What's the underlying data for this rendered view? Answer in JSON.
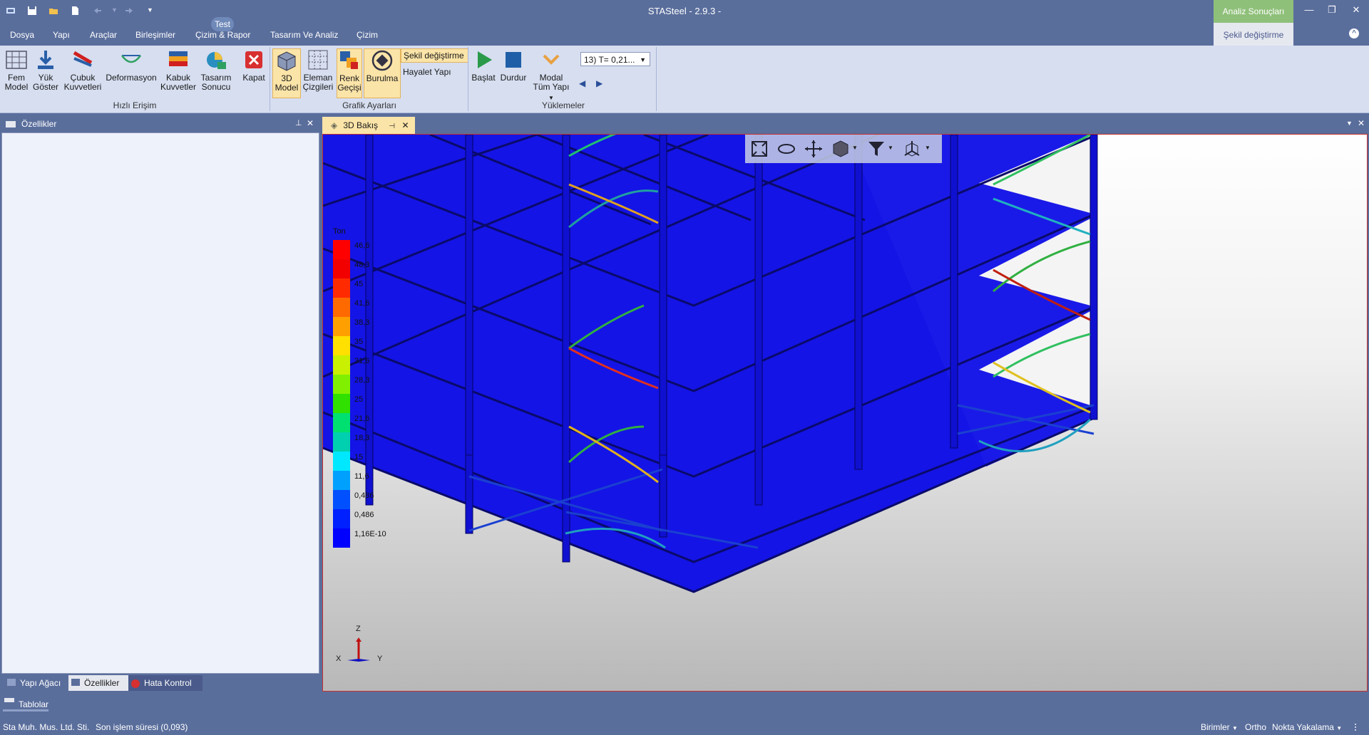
{
  "app": {
    "title": "STASteel - 2.9.3 -",
    "context_tab": "Analiz Sonuçları",
    "context_subtab": "Şekil değiştirme",
    "badge": "Test"
  },
  "menu": [
    "Dosya",
    "Yapı",
    "Araçlar",
    "Birleşimler",
    "Çizim & Rapor",
    "Tasarım Ve Analiz",
    "Çizim"
  ],
  "ribbon": {
    "hizli": {
      "label": "Hızlı Erişim",
      "buttons": [
        {
          "l1": "Fem",
          "l2": "Model"
        },
        {
          "l1": "Yük",
          "l2": "Göster"
        },
        {
          "l1": "Çubuk",
          "l2": "Kuvvetleri"
        },
        {
          "l1": "Deformasyon",
          "l2": ""
        },
        {
          "l1": "Kabuk",
          "l2": "Kuvvetler"
        },
        {
          "l1": "Tasarım",
          "l2": "Sonucu"
        },
        {
          "l1": "Kapat",
          "l2": ""
        }
      ]
    },
    "grafik": {
      "label": "Grafik Ayarları",
      "buttons": [
        {
          "l1": "3D",
          "l2": "Model"
        },
        {
          "l1": "Eleman",
          "l2": "Çizgileri"
        },
        {
          "l1": "Renk",
          "l2": "Geçişi"
        },
        {
          "l1": "Burulma",
          "l2": ""
        }
      ],
      "sekil": "Şekil değiştirme",
      "hayalet": "Hayalet Yapı"
    },
    "yuklemeler": {
      "label": "Yüklemeler",
      "baslat": "Başlat",
      "durdur": "Durdur",
      "modal_l1": "Modal",
      "modal_l2": "Tüm Yapı",
      "mode_value": "13) T= 0,21..."
    }
  },
  "left_panel": {
    "title": "Özellikler",
    "tabs": [
      "Yapı Ağacı",
      "Özellikler",
      "Hata Kontrol"
    ]
  },
  "tablolar": "Tablolar",
  "doc_tab": "3D Bakış",
  "legend": {
    "unit": "Ton",
    "values": [
      "46,6",
      "48,3",
      "45",
      "41,6",
      "38,3",
      "35",
      "31,6",
      "28,3",
      "25",
      "21,6",
      "18,3",
      "15",
      "11,6",
      "0,486",
      "0,486",
      "1,16E-10"
    ],
    "colors": [
      "#ff0000",
      "#f20000",
      "#ff2a00",
      "#ff6a00",
      "#ffa000",
      "#ffe000",
      "#c8f000",
      "#80f000",
      "#30e000",
      "#00e070",
      "#00d0b0",
      "#00e8ff",
      "#00a0ff",
      "#0050ff",
      "#0020ff",
      "#0000ff"
    ]
  },
  "axes": {
    "z": "Z",
    "x": "X",
    "y": "Y"
  },
  "status": {
    "company": "Sta Muh. Mus. Ltd. Sti.",
    "last_op": "Son işlem süresi (0,093)",
    "birimler": "Birimler",
    "ortho": "Ortho",
    "nokta": "Nokta Yakalama"
  }
}
